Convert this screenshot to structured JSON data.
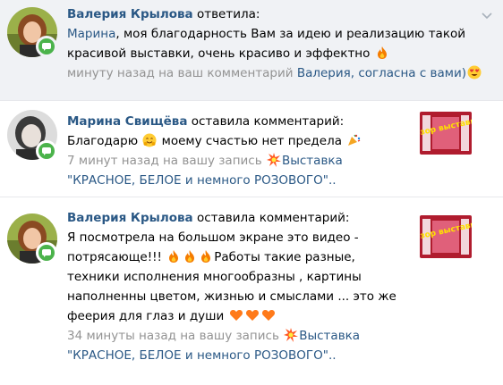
{
  "notifications": [
    {
      "author": "Валерия Крылова",
      "action": "ответила:",
      "mention": "Марина",
      "text": ", моя благодарность Вам за идею и реализацию такой красивой выставки, очень красиво и эффектно",
      "time": "минуту назад на ваш комментарий",
      "target": "Валерия, согласна с вами)"
    },
    {
      "author": "Марина Свищёва",
      "action": "оставила комментарий:",
      "text_before": "Благодарю",
      "text_after": "моему счастью нет предела",
      "time": "7 минут назад на вашу запись",
      "target": "Выставка \"КРАСНОЕ, БЕЛОЕ и немного РОЗОВОГО\".."
    },
    {
      "author": "Валерия Крылова",
      "action": "оставила комментарий:",
      "text_1": "Я посмотрела на большом экране это видео - потрясающе!!!",
      "text_2": "Работы такие разные, техники исполнения многообразны , картины наполненны цветом, жизнью и смыслами ... это же феерия для глаз и души",
      "time": "34 минуты назад на вашу запись",
      "target": "Выставка \"КРАСНОЕ, БЕЛОЕ и немного РОЗОВОГО\".."
    }
  ],
  "thumbnail_label": "обзор выставки",
  "colors": {
    "link": "#2a5885",
    "meta": "#939393",
    "highlight": "#f0f2f5",
    "badge": "#4bb34b"
  }
}
